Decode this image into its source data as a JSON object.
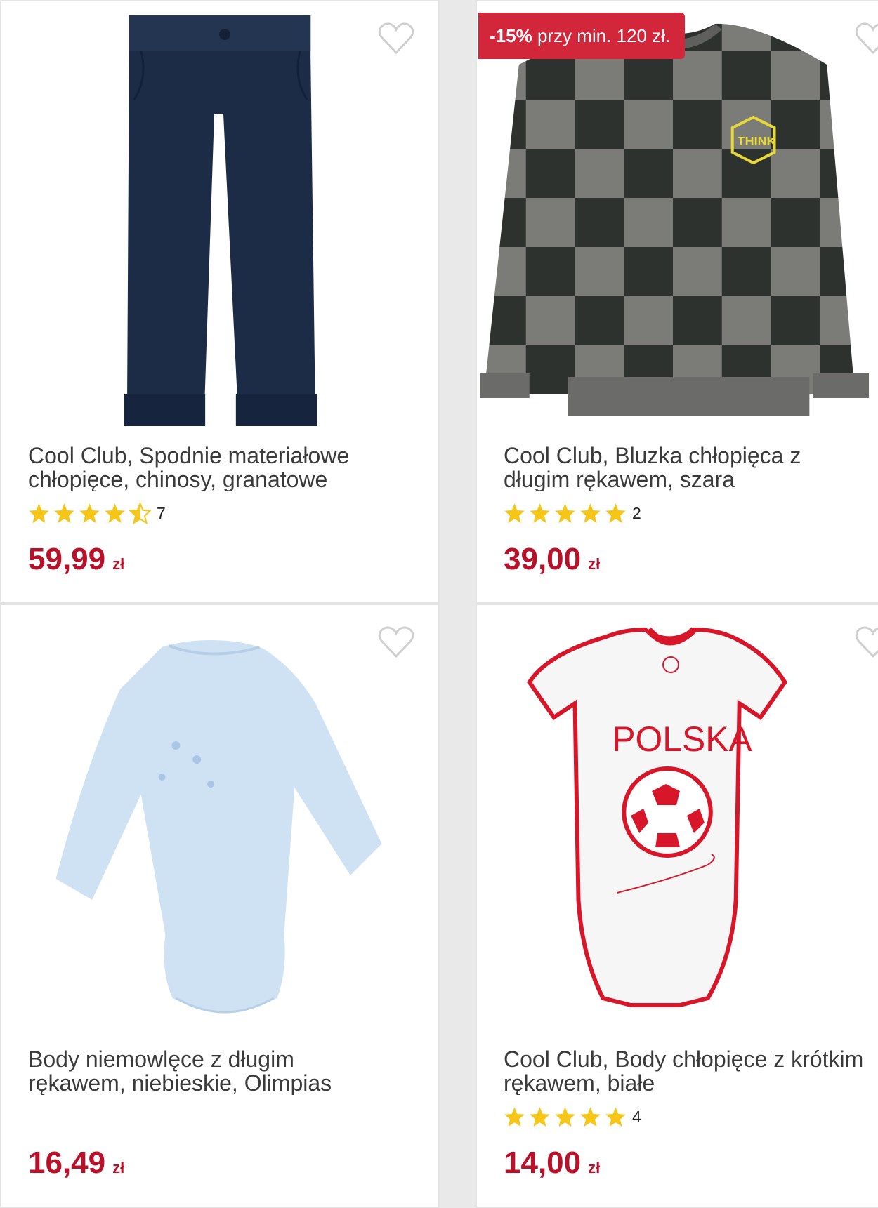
{
  "products": [
    {
      "title_line1": "Cool Club, Spodnie materiałowe",
      "title_line2": "chłopięce, chinosy, granatowe",
      "rating": 4.5,
      "rating_count": "7",
      "price": "59,99",
      "currency": "zł",
      "image": "navy-chino-pants"
    },
    {
      "badge_bold": "-15%",
      "badge_text": "przy min. 120 zł.",
      "title_line1": "Cool Club, Bluzka chłopięca z",
      "title_line2": "długim rękawem, szara",
      "rating": 5,
      "rating_count": "2",
      "price": "39,00",
      "currency": "zł",
      "image": "checkered-grey-sweatshirt",
      "print_text": "THINK"
    },
    {
      "title_line1": "Body niemowlęce z długim",
      "title_line2": "rękawem, niebieskie, Olimpias",
      "price": "16,49",
      "currency": "zł",
      "image": "light-blue-baby-bodysuit"
    },
    {
      "title_line1": "Cool Club, Body chłopięce z krótkim",
      "title_line2": "rękawem, białe",
      "rating": 5,
      "rating_count": "4",
      "price": "14,00",
      "currency": "zł",
      "image": "white-polska-bodysuit",
      "print_text": "POLSKA"
    }
  ],
  "colors": {
    "price": "#b8122b",
    "badge": "#d2263b",
    "star": "#f5c518"
  }
}
